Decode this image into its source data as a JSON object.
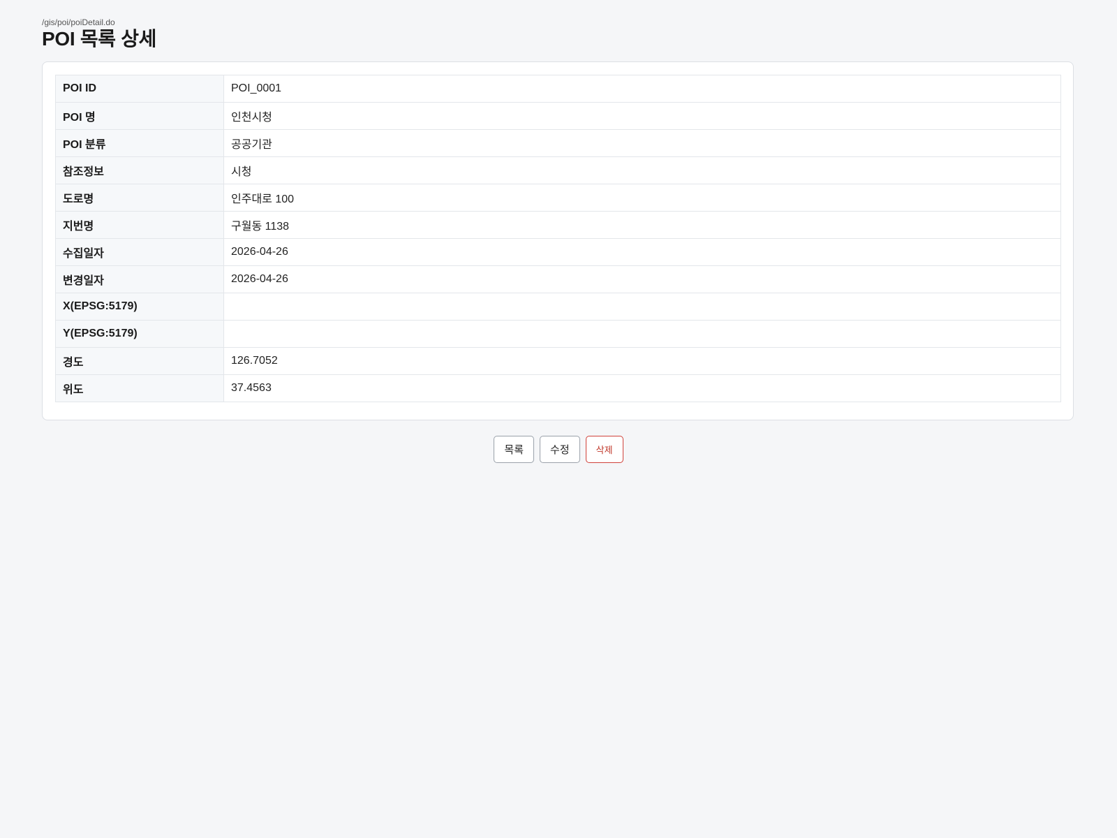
{
  "header": {
    "path": "/gis/poi/poiDetail.do",
    "title": "POI 목록 상세"
  },
  "detail": {
    "rows": [
      {
        "label": "POI ID",
        "value": "POI_0001"
      },
      {
        "label": "POI 명",
        "value": "인천시청"
      },
      {
        "label": "POI 분류",
        "value": "공공기관"
      },
      {
        "label": "참조정보",
        "value": "시청"
      },
      {
        "label": "도로명",
        "value": "인주대로 100"
      },
      {
        "label": "지번명",
        "value": "구월동 1138"
      },
      {
        "label": "수집일자",
        "value": "2026-04-26"
      },
      {
        "label": "변경일자",
        "value": "2026-04-26"
      },
      {
        "label": "X(EPSG:5179)",
        "value": ""
      },
      {
        "label": "Y(EPSG:5179)",
        "value": ""
      },
      {
        "label": "경도",
        "value": "126.7052"
      },
      {
        "label": "위도",
        "value": "37.4563"
      }
    ]
  },
  "actions": {
    "list_label": "목록",
    "edit_label": "수정",
    "delete_label": "삭제"
  },
  "colors": {
    "background": "#f5f6f8",
    "danger": "#c0392b"
  }
}
